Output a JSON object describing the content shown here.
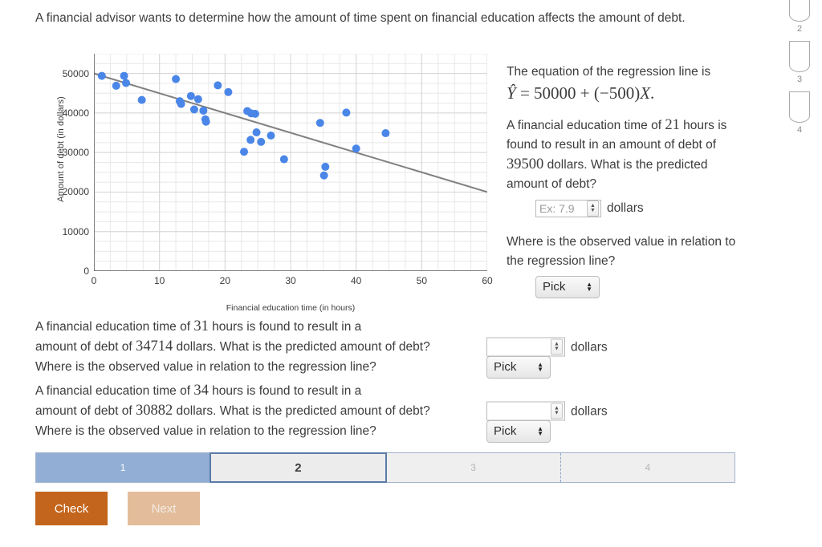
{
  "intro": "A financial advisor wants to determine how the amount of time spent on financial education affects the amount of debt.",
  "chart_data": {
    "type": "scatter",
    "title": "",
    "xlabel": "Financial education time (in hours)",
    "ylabel": "Amount of debt (in dollars)",
    "xlim": [
      0,
      60
    ],
    "ylim": [
      0,
      55000
    ],
    "xticks": [
      0,
      10,
      20,
      30,
      40,
      50,
      60
    ],
    "yticks": [
      0,
      10000,
      20000,
      30000,
      40000,
      50000
    ],
    "ytick_labels": [
      "0",
      "10000",
      "20000",
      "30000",
      "40000",
      "50000"
    ],
    "xtick_labels": [
      "0",
      "10",
      "20",
      "30",
      "40",
      "50",
      "60"
    ],
    "grid": true,
    "minor_grid_x_step": 2.5,
    "minor_grid_y_step": 2500,
    "point_color": "#4a86e8",
    "line_color": "#808080",
    "legend": null,
    "regression_line": {
      "intercept": 50000,
      "slope": -500,
      "x_start": 0,
      "x_end": 60,
      "y_start": 50000,
      "y_end": 20000
    },
    "points": [
      {
        "x": 1.2,
        "y": 49400
      },
      {
        "x": 3.4,
        "y": 46900
      },
      {
        "x": 4.6,
        "y": 49400
      },
      {
        "x": 4.9,
        "y": 47600
      },
      {
        "x": 7.3,
        "y": 43300
      },
      {
        "x": 12.5,
        "y": 48600
      },
      {
        "x": 13.1,
        "y": 43000
      },
      {
        "x": 13.3,
        "y": 42300
      },
      {
        "x": 14.8,
        "y": 44300
      },
      {
        "x": 15.9,
        "y": 43500
      },
      {
        "x": 15.3,
        "y": 40900
      },
      {
        "x": 16.7,
        "y": 40600
      },
      {
        "x": 17.0,
        "y": 38400
      },
      {
        "x": 17.1,
        "y": 37800
      },
      {
        "x": 18.9,
        "y": 47000
      },
      {
        "x": 20.5,
        "y": 45300
      },
      {
        "x": 23.4,
        "y": 40500
      },
      {
        "x": 24.6,
        "y": 39800
      },
      {
        "x": 24.8,
        "y": 35100
      },
      {
        "x": 23.9,
        "y": 33200
      },
      {
        "x": 22.9,
        "y": 30200
      },
      {
        "x": 27.0,
        "y": 34300
      },
      {
        "x": 24.0,
        "y": 39900
      },
      {
        "x": 25.5,
        "y": 32700
      },
      {
        "x": 29.0,
        "y": 28300
      },
      {
        "x": 34.5,
        "y": 37500
      },
      {
        "x": 35.3,
        "y": 26400
      },
      {
        "x": 35.1,
        "y": 24200
      },
      {
        "x": 38.5,
        "y": 40100
      },
      {
        "x": 40.0,
        "y": 31000
      },
      {
        "x": 44.5,
        "y": 34900
      }
    ]
  },
  "right_panel": {
    "intro_text": "The equation of the regression line is",
    "equation": {
      "yhat": "Ŷ",
      "equals": "=",
      "intercept": "50000",
      "plus": "+",
      "slope": "(−500)",
      "x": "X",
      "period": "."
    },
    "question_prefix": "A financial education time of",
    "hours_value": "21",
    "question_mid": "hours is found to result in an amount of debt of",
    "debt_value": "39500",
    "question_suffix": "dollars. What is the predicted amount of debt?",
    "input_placeholder": "Ex: 7.9",
    "unit_label": "dollars",
    "relation_question": "Where is the observed value in relation to the regression line?",
    "pick_label": "Pick"
  },
  "lower_questions": [
    {
      "line1_prefix": "A financial education time of",
      "hours_value": "31",
      "line1_suffix": "hours is found to result in a",
      "line2_prefix": "amount of debt of",
      "debt_value": "34714",
      "line2_suffix": "dollars. What is the predicted amount of debt?",
      "input_value": "",
      "unit_label": "dollars",
      "relation_question": "Where is the observed value in relation to the regression line?",
      "pick_label": "Pick"
    },
    {
      "line1_prefix": "A financial education time of",
      "hours_value": "34",
      "line1_suffix": "hours is found to result in a",
      "line2_prefix": "amount of debt of",
      "debt_value": "30882",
      "line2_suffix": "dollars. What is the predicted amount of debt?",
      "input_value": "",
      "unit_label": "dollars",
      "relation_question": "Where is the observed value in relation to the regression line?",
      "pick_label": "Pick"
    }
  ],
  "progress": {
    "segments": [
      {
        "label": "1",
        "state": "done"
      },
      {
        "label": "2",
        "state": "current"
      },
      {
        "label": "3",
        "state": "todo"
      },
      {
        "label": "4",
        "state": "todo"
      }
    ],
    "done_color": "#92aed4",
    "current_border_color": "#5b7aa8"
  },
  "buttons": {
    "check_label": "Check",
    "check_color": "#c3651c",
    "next_label": "Next",
    "next_color": "#e3bd9b"
  },
  "rail": {
    "items": [
      {
        "label": "2",
        "icon": "shield-icon"
      },
      {
        "label": "3",
        "icon": "shield-icon"
      },
      {
        "label": "4",
        "icon": "shield-icon"
      }
    ]
  }
}
